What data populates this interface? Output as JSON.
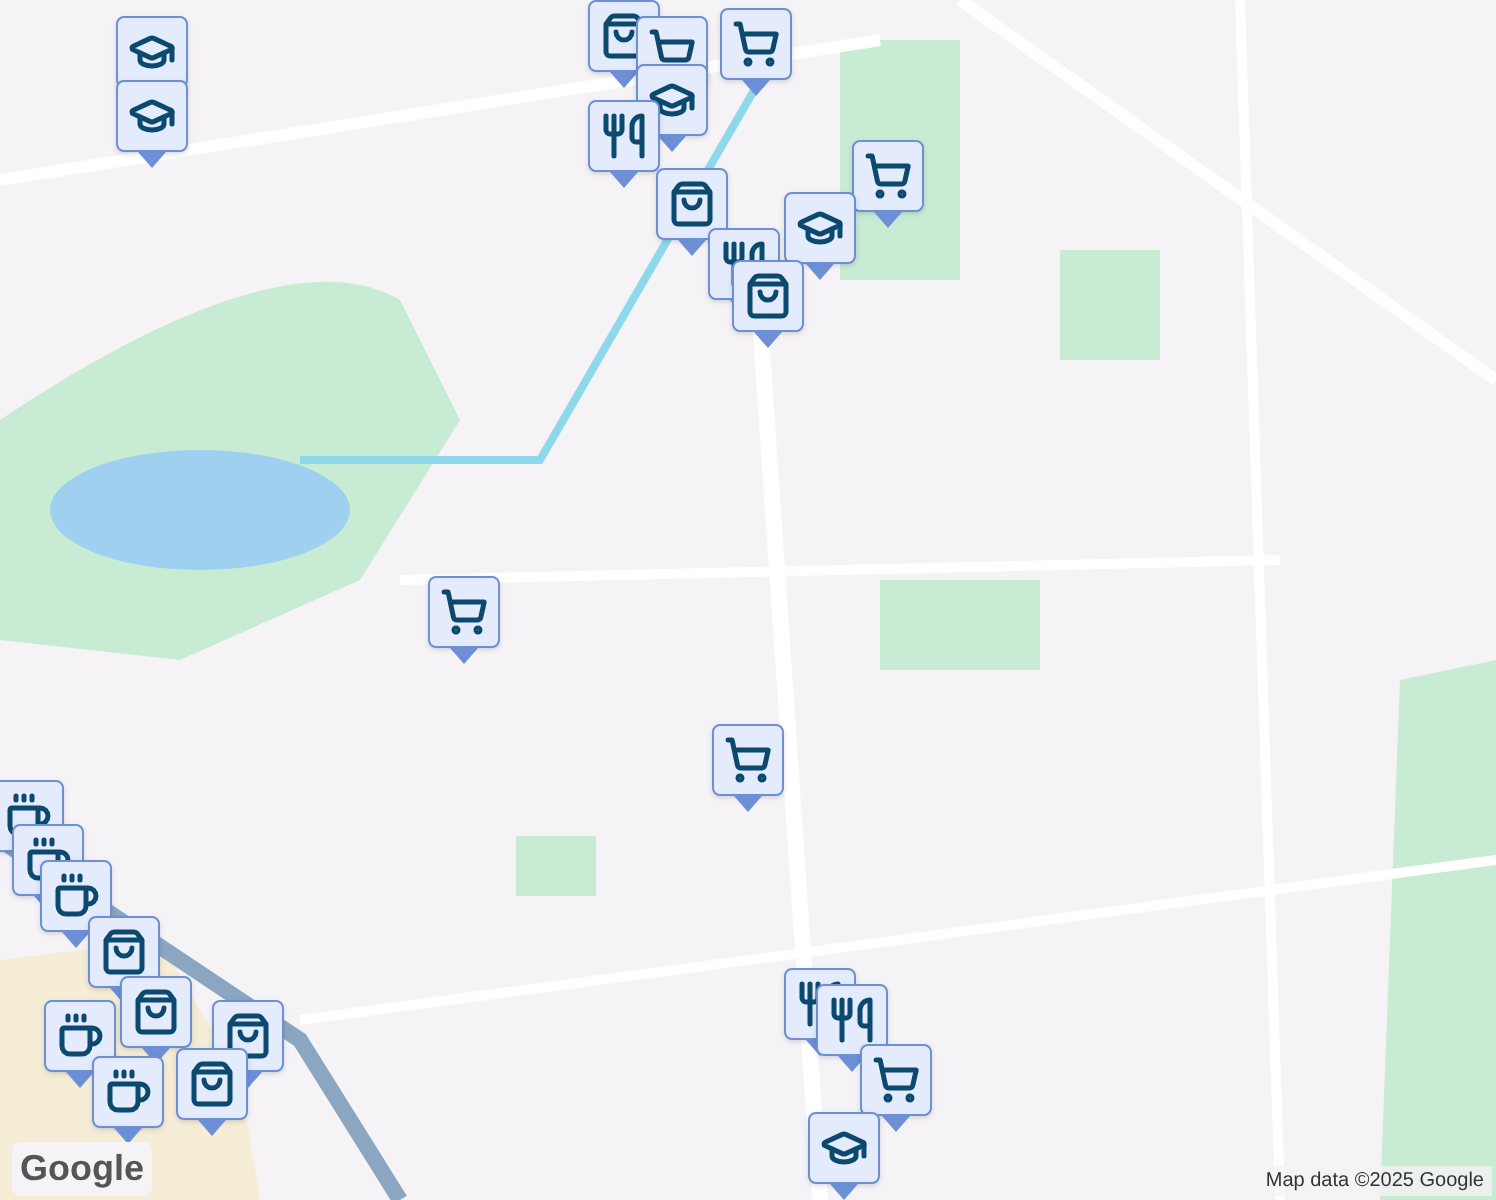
{
  "markers": [
    {
      "kind": "school"
    },
    {
      "kind": "school"
    },
    {
      "kind": "shopping"
    },
    {
      "kind": "cart"
    },
    {
      "kind": "cart"
    },
    {
      "kind": "school"
    },
    {
      "kind": "food"
    },
    {
      "kind": "shopping"
    },
    {
      "kind": "cart"
    },
    {
      "kind": "school"
    },
    {
      "kind": "food"
    },
    {
      "kind": "shopping"
    },
    {
      "kind": "cart"
    },
    {
      "kind": "cart"
    },
    {
      "kind": "coffee"
    },
    {
      "kind": "coffee"
    },
    {
      "kind": "coffee"
    },
    {
      "kind": "shopping"
    },
    {
      "kind": "shopping"
    },
    {
      "kind": "shopping"
    },
    {
      "kind": "coffee"
    },
    {
      "kind": "coffee"
    },
    {
      "kind": "shopping"
    },
    {
      "kind": "food"
    },
    {
      "kind": "food"
    },
    {
      "kind": "cart"
    },
    {
      "kind": "school"
    }
  ],
  "attribution": "Map data ©2025 Google",
  "logo": "Google"
}
